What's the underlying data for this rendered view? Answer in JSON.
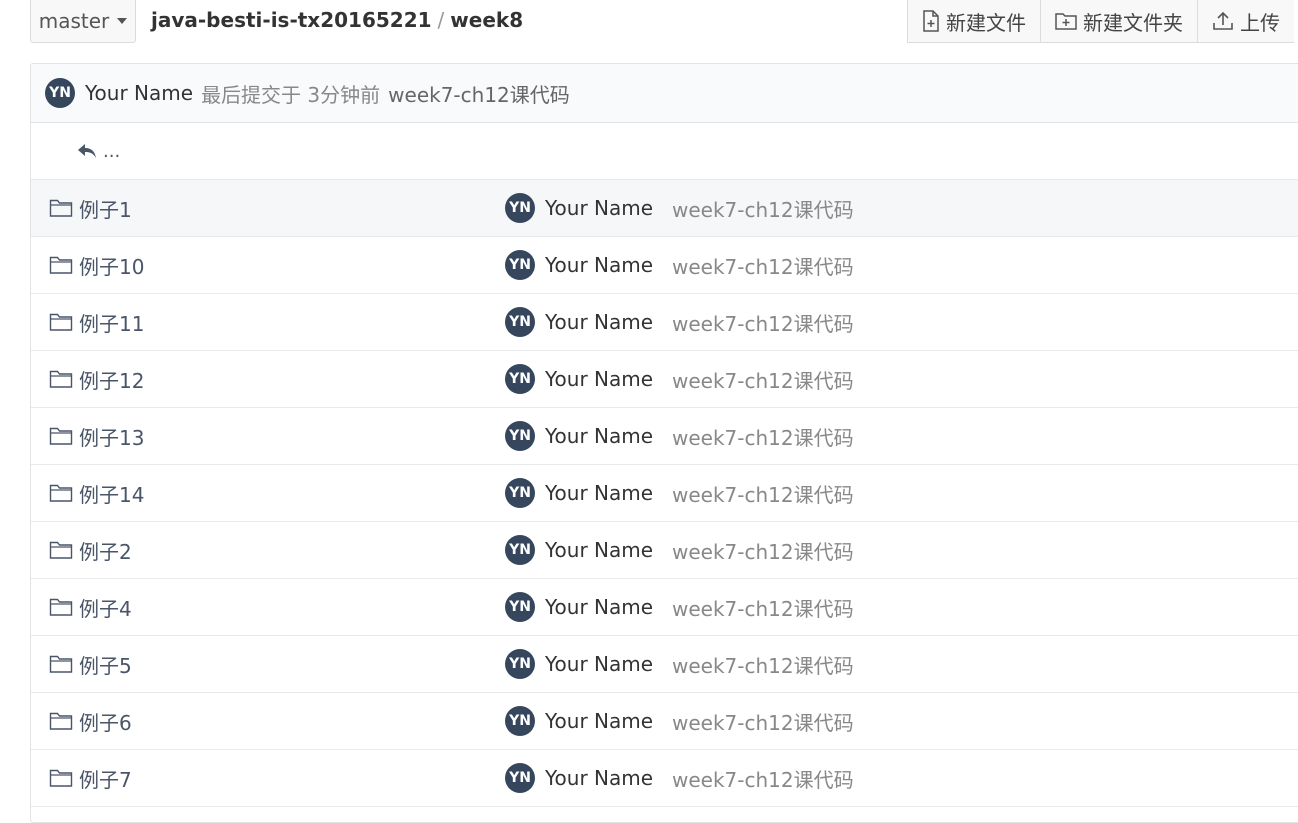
{
  "toolbar": {
    "branch": "master",
    "breadcrumb": [
      "java-besti-is-tx20165221",
      "week8"
    ],
    "breadcrumb_sep": "/",
    "actions": [
      "新建文件",
      "新建文件夹",
      "上传"
    ]
  },
  "commit": {
    "avatar": "YN",
    "author": "Your Name",
    "meta": "最后提交于 3分钟前",
    "message": "week7-ch12课代码"
  },
  "parent_dir": "...",
  "files": [
    {
      "name": "例子1",
      "avatar": "YN",
      "author": "Your Name",
      "message": "week7-ch12课代码"
    },
    {
      "name": "例子10",
      "avatar": "YN",
      "author": "Your Name",
      "message": "week7-ch12课代码"
    },
    {
      "name": "例子11",
      "avatar": "YN",
      "author": "Your Name",
      "message": "week7-ch12课代码"
    },
    {
      "name": "例子12",
      "avatar": "YN",
      "author": "Your Name",
      "message": "week7-ch12课代码"
    },
    {
      "name": "例子13",
      "avatar": "YN",
      "author": "Your Name",
      "message": "week7-ch12课代码"
    },
    {
      "name": "例子14",
      "avatar": "YN",
      "author": "Your Name",
      "message": "week7-ch12课代码"
    },
    {
      "name": "例子2",
      "avatar": "YN",
      "author": "Your Name",
      "message": "week7-ch12课代码"
    },
    {
      "name": "例子4",
      "avatar": "YN",
      "author": "Your Name",
      "message": "week7-ch12课代码"
    },
    {
      "name": "例子5",
      "avatar": "YN",
      "author": "Your Name",
      "message": "week7-ch12课代码"
    },
    {
      "name": "例子6",
      "avatar": "YN",
      "author": "Your Name",
      "message": "week7-ch12课代码"
    },
    {
      "name": "例子7",
      "avatar": "YN",
      "author": "Your Name",
      "message": "week7-ch12课代码"
    }
  ]
}
